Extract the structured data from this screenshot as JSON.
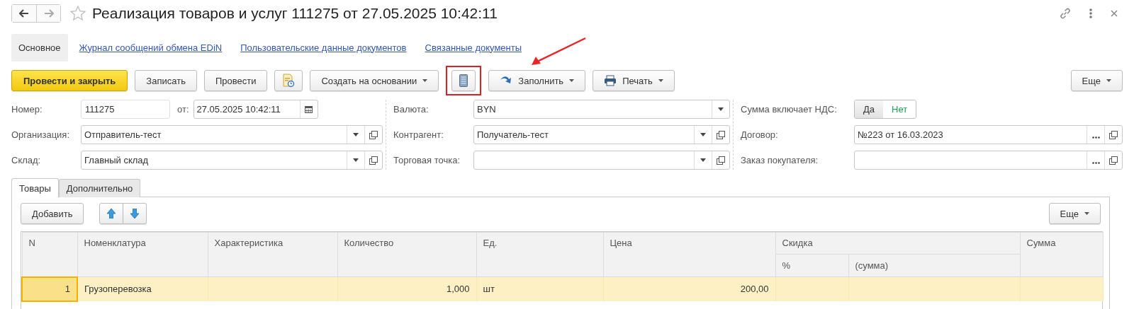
{
  "window": {
    "title": "Реализация товаров и услуг 111275 от 27.05.2025 10:42:11",
    "favorite": false
  },
  "nav_tabs": [
    {
      "label": "Основное",
      "selected": true
    },
    {
      "label": "Журнал сообщений обмена EDiN",
      "selected": false
    },
    {
      "label": "Пользовательские данные документов",
      "selected": false
    },
    {
      "label": "Связанные документы",
      "selected": false
    }
  ],
  "toolbar": [
    {
      "kind": "primary",
      "label": "Провести и закрыть",
      "highlighted": false
    },
    {
      "kind": "plain",
      "label": "Записать",
      "highlighted": false
    },
    {
      "kind": "plain",
      "label": "Провести",
      "highlighted": false
    },
    {
      "kind": "report",
      "highlighted": false
    },
    {
      "kind": "menu",
      "label": "Создать на основании",
      "highlighted": false
    },
    {
      "kind": "list",
      "highlighted": true
    },
    {
      "kind": "fill",
      "label": "Заполнить",
      "highlighted": false
    },
    {
      "kind": "print",
      "label": "Печать",
      "highlighted": false
    },
    {
      "kind": "more",
      "label": "Еще",
      "highlighted": false
    }
  ],
  "form_columns": [
    {
      "rows": [
        {
          "fields": [
            {
              "kind": "text",
              "label": "Номер:",
              "value": "111275"
            },
            {
              "kind": "date",
              "label": "от:",
              "value": "27.05.2025 10:42:11"
            }
          ]
        },
        {
          "fields": [
            {
              "kind": "select-open",
              "label": "Организация:",
              "value": "Отправитель-тест"
            }
          ]
        },
        {
          "fields": [
            {
              "kind": "select-open",
              "label": "Склад:",
              "value": "Главный склад"
            }
          ]
        }
      ]
    },
    {
      "rows": [
        {
          "fields": [
            {
              "kind": "select",
              "label": "Валюта:",
              "value": "BYN"
            }
          ]
        },
        {
          "fields": [
            {
              "kind": "select-open",
              "label": "Контрагент:",
              "value": "Получатель-тест"
            }
          ]
        },
        {
          "fields": [
            {
              "kind": "select-open",
              "label": "Торговая точка:"
            }
          ]
        }
      ]
    },
    {
      "rows": [
        {
          "fields": [
            {
              "kind": "toggle",
              "label": "Сумма включает НДС:",
              "options": [
                {
                  "label": "Да",
                  "selected": true
                },
                {
                  "label": "Нет",
                  "selected": false
                }
              ]
            }
          ]
        },
        {
          "fields": [
            {
              "kind": "choice-open",
              "label": "Договор:",
              "value": "№223 от 16.03.2023"
            }
          ]
        },
        {
          "fields": [
            {
              "kind": "choice-open",
              "label": "Заказ покупателя:"
            }
          ]
        }
      ]
    }
  ],
  "tabs": [
    {
      "label": "Товары",
      "selected": true
    },
    {
      "label": "Дополнительно",
      "selected": false
    }
  ],
  "table_toolbar": {
    "add": "Добавить",
    "more": "Еще"
  },
  "table": {
    "columns": [
      {
        "label": "N",
        "kind": "number"
      },
      {
        "label": "Номенклатура",
        "kind": "text"
      },
      {
        "label": "Характеристика",
        "kind": "text"
      },
      {
        "label": "Количество",
        "kind": "number"
      },
      {
        "label": "Ед.",
        "kind": "text"
      },
      {
        "label": "Цена",
        "kind": "number"
      },
      {
        "label": "Скидка",
        "kind": "group",
        "children": [
          {
            "label": "%"
          },
          {
            "label": "(сумма)"
          }
        ]
      },
      {
        "label": "Сумма",
        "kind": "number"
      }
    ],
    "rows": [
      {
        "selected": true,
        "cells": [
          "1",
          "Грузоперевозка",
          null,
          "1,000",
          "шт",
          "200,00",
          null,
          null,
          null
        ]
      }
    ]
  }
}
